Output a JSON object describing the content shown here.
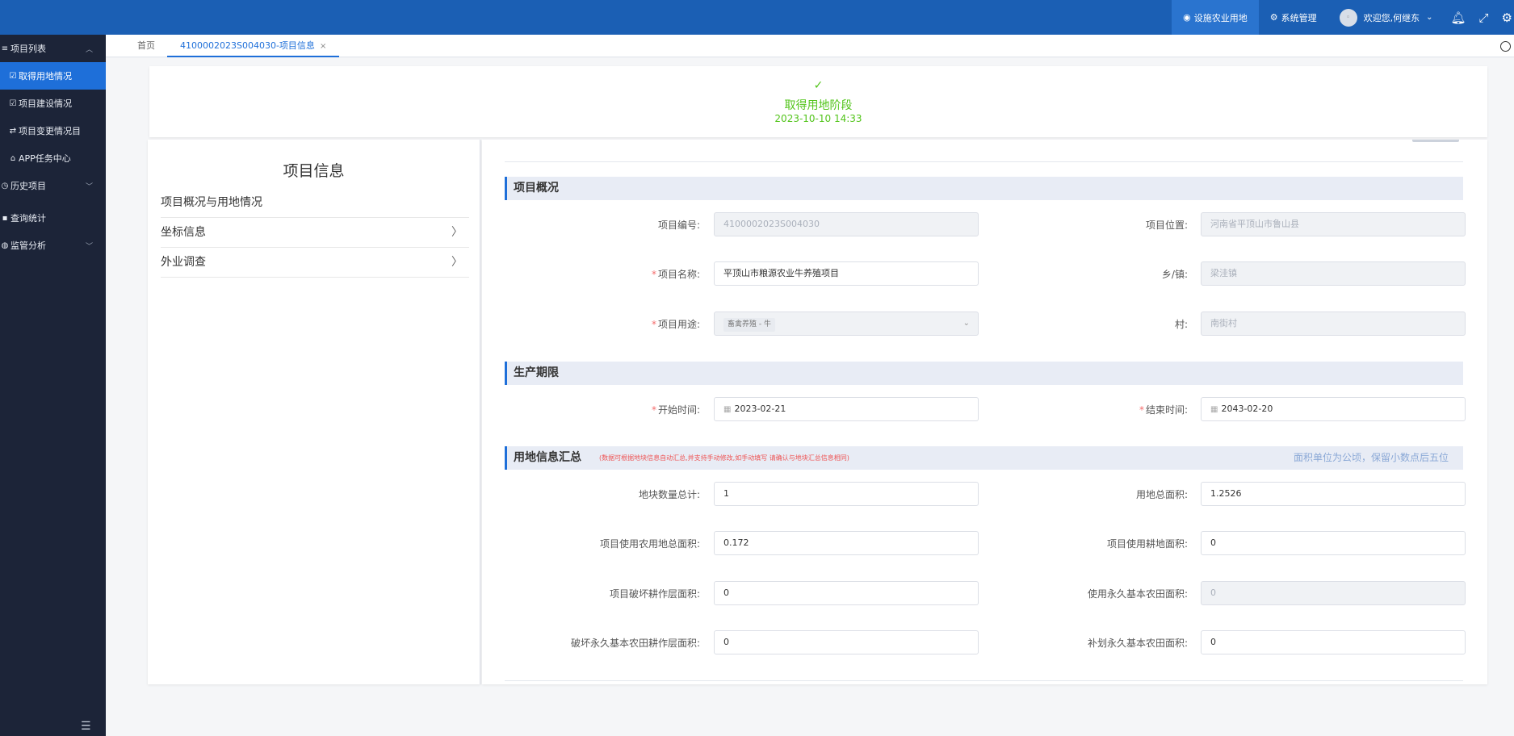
{
  "topbar": {
    "module": "设施农业用地",
    "system": "系统管理",
    "user": "欢迎您,何继东"
  },
  "sidebar": {
    "items": [
      {
        "label": "项目列表"
      },
      {
        "label": "取得用地情况"
      },
      {
        "label": "项目建设情况"
      },
      {
        "label": "项目变更情况目"
      },
      {
        "label": "APP任务中心"
      },
      {
        "label": "历史项目"
      },
      {
        "label": "查询统计"
      },
      {
        "label": "监管分析"
      }
    ]
  },
  "tabs": [
    {
      "label": "首页"
    },
    {
      "label": "4100002023S004030-项目信息"
    }
  ],
  "stage": {
    "title": "取得用地阶段",
    "time": "2023-10-10 14:33"
  },
  "left_panel": {
    "title": "项目信息",
    "items": [
      "项目概况与用地情况",
      "坐标信息",
      "外业调查"
    ]
  },
  "sections": {
    "overview": "项目概况",
    "period": "生产期限",
    "land": "用地信息汇总",
    "land_note": "(数据可根据地块信息自动汇总,并支持手动修改,如手动填写 请确认与地块汇总信息相同)",
    "land_right": "面积单位为公顷，保留小数点后五位"
  },
  "fields": {
    "project_no": {
      "label": "项目编号:",
      "value": "4100002023S004030"
    },
    "location": {
      "label": "项目位置:",
      "value": "河南省平顶山市鲁山县"
    },
    "name": {
      "label": "项目名称:",
      "value": "平顶山市粮源农业牛养殖项目"
    },
    "town": {
      "label": "乡/镇:",
      "value": "梁洼镇"
    },
    "usage": {
      "label": "项目用途:",
      "value": "畜禽养殖 - 牛"
    },
    "village": {
      "label": "村:",
      "value": "南街村"
    },
    "start": {
      "label": "开始时间:",
      "value": "2023-02-21"
    },
    "end": {
      "label": "结束时间:",
      "value": "2043-02-20"
    },
    "parcel_count": {
      "label": "地块数量总计:",
      "value": "1"
    },
    "total_area": {
      "label": "用地总面积:",
      "value": "1.2526"
    },
    "agri_area": {
      "label": "项目使用农用地总面积:",
      "value": "0.172"
    },
    "cultivated_area": {
      "label": "项目使用耕地面积:",
      "value": "0"
    },
    "damaged_area": {
      "label": "项目破坏耕作层面积:",
      "value": "0"
    },
    "perm_basic_area": {
      "label": "使用永久基本农田面积:",
      "value": "0"
    },
    "perm_damaged_area": {
      "label": "破坏永久基本农田耕作层面积:",
      "value": "0"
    },
    "supplement_area": {
      "label": "补划永久基本农田面积:",
      "value": "0"
    }
  },
  "colors": {
    "topbar": "#1b5fb4",
    "sidebar": "#1c2438",
    "accent": "#1e6fd9",
    "success": "#52c41a",
    "required": "#f56c6c"
  }
}
